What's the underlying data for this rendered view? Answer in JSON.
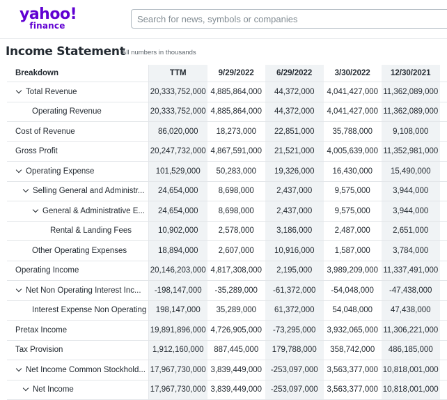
{
  "header": {
    "logo_text": "yahoo!",
    "logo_sub": "finance",
    "search_placeholder": "Search for news, symbols or companies",
    "brand_color": "#6001d2"
  },
  "page": {
    "title": "Income Statement",
    "note": "All numbers in thousands"
  },
  "table": {
    "columns": [
      "Breakdown",
      "TTM",
      "9/29/2022",
      "6/29/2022",
      "3/30/2022",
      "12/30/2021"
    ],
    "rows": [
      {
        "label": "Total Revenue",
        "indent": 1,
        "expand": true,
        "values": [
          "20,333,752,000",
          "4,885,864,000",
          "44,372,000",
          "4,041,427,000",
          "11,362,089,000"
        ]
      },
      {
        "label": "Operating Revenue",
        "indent": 2,
        "expand": false,
        "values": [
          "20,333,752,000",
          "4,885,864,000",
          "44,372,000",
          "4,041,427,000",
          "11,362,089,000"
        ]
      },
      {
        "label": "Cost of Revenue",
        "indent": 0,
        "expand": false,
        "values": [
          "86,020,000",
          "18,273,000",
          "22,851,000",
          "35,788,000",
          "9,108,000"
        ]
      },
      {
        "label": "Gross Profit",
        "indent": 0,
        "expand": false,
        "values": [
          "20,247,732,000",
          "4,867,591,000",
          "21,521,000",
          "4,005,639,000",
          "11,352,981,000"
        ]
      },
      {
        "label": "Operating Expense",
        "indent": 1,
        "expand": true,
        "values": [
          "101,529,000",
          "50,283,000",
          "19,326,000",
          "16,430,000",
          "15,490,000"
        ]
      },
      {
        "label": "Selling General and Administr...",
        "indent": 2,
        "expand": true,
        "values": [
          "24,654,000",
          "8,698,000",
          "2,437,000",
          "9,575,000",
          "3,944,000"
        ]
      },
      {
        "label": "General & Administrative E...",
        "indent": 3,
        "expand": true,
        "values": [
          "24,654,000",
          "8,698,000",
          "2,437,000",
          "9,575,000",
          "3,944,000"
        ]
      },
      {
        "label": "Rental & Landing Fees",
        "indent": 4,
        "expand": false,
        "values": [
          "10,902,000",
          "2,578,000",
          "3,186,000",
          "2,487,000",
          "2,651,000"
        ]
      },
      {
        "label": "Other Operating Expenses",
        "indent": 2,
        "expand": false,
        "values": [
          "18,894,000",
          "2,607,000",
          "10,916,000",
          "1,587,000",
          "3,784,000"
        ]
      },
      {
        "label": "Operating Income",
        "indent": 0,
        "expand": false,
        "values": [
          "20,146,203,000",
          "4,817,308,000",
          "2,195,000",
          "3,989,209,000",
          "11,337,491,000"
        ]
      },
      {
        "label": "Net Non Operating Interest Inc...",
        "indent": 1,
        "expand": true,
        "values": [
          "-198,147,000",
          "-35,289,000",
          "-61,372,000",
          "-54,048,000",
          "-47,438,000"
        ]
      },
      {
        "label": "Interest Expense Non Operating",
        "indent": 2,
        "expand": false,
        "values": [
          "198,147,000",
          "35,289,000",
          "61,372,000",
          "54,048,000",
          "47,438,000"
        ]
      },
      {
        "label": "Pretax Income",
        "indent": 0,
        "expand": false,
        "values": [
          "19,891,896,000",
          "4,726,905,000",
          "-73,295,000",
          "3,932,065,000",
          "11,306,221,000"
        ]
      },
      {
        "label": "Tax Provision",
        "indent": 0,
        "expand": false,
        "values": [
          "1,912,160,000",
          "887,445,000",
          "179,788,000",
          "358,742,000",
          "486,185,000"
        ]
      },
      {
        "label": "Net Income Common Stockhold...",
        "indent": 1,
        "expand": true,
        "values": [
          "17,967,730,000",
          "3,839,449,000",
          "-253,097,000",
          "3,563,377,000",
          "10,818,001,000"
        ]
      },
      {
        "label": "Net Income",
        "indent": 2,
        "expand": true,
        "values": [
          "17,967,730,000",
          "3,839,449,000",
          "-253,097,000",
          "3,563,377,000",
          "10,818,001,000"
        ]
      }
    ]
  }
}
